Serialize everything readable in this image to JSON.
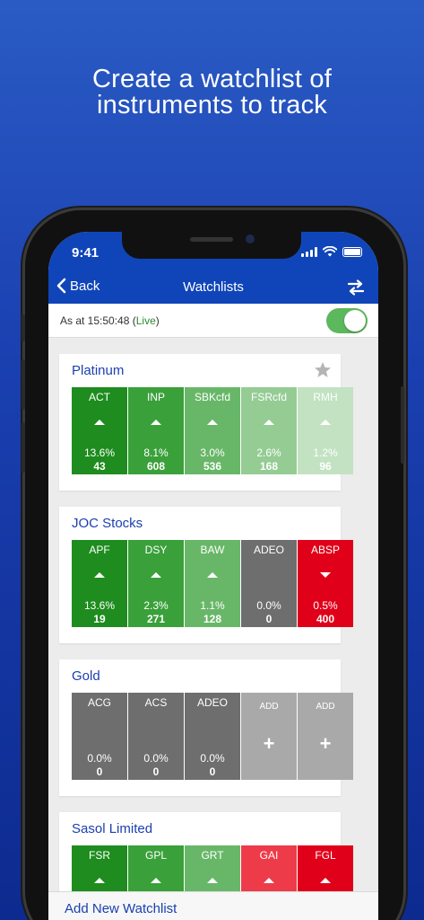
{
  "headline": {
    "line1": "Create a watchlist of",
    "line2": "instruments to track"
  },
  "status_bar": {
    "time": "9:41"
  },
  "nav": {
    "back_label": "Back",
    "title": "Watchlists"
  },
  "as_at": {
    "prefix": "As at 15:50:48 (",
    "live": "Live",
    "suffix": ")",
    "toggle_on": true
  },
  "colors": {
    "brand_blue": "#1045b9",
    "up_strong": "#1e8c1e",
    "up_medium": "#3aa03a",
    "up_light": "#68b768",
    "up_lighter": "#94cc94",
    "up_faint": "#c2e2c2",
    "neutral": "#6e6e6e",
    "down_strong": "#e1001a",
    "down_light": "#ee3b49",
    "add_tile": "#a9a9a9"
  },
  "watchlists": [
    {
      "name": "Platinum",
      "starred": false,
      "tiles": [
        {
          "symbol": "ACT",
          "direction": "up",
          "change": "13.6%",
          "value": "43",
          "color": "#1e8c1e"
        },
        {
          "symbol": "INP",
          "direction": "up",
          "change": "8.1%",
          "value": "608",
          "color": "#3aa03a"
        },
        {
          "symbol": "SBKcfd",
          "direction": "up",
          "change": "3.0%",
          "value": "536",
          "color": "#68b768"
        },
        {
          "symbol": "FSRcfd",
          "direction": "up",
          "change": "2.6%",
          "value": "168",
          "color": "#94cc94"
        },
        {
          "symbol": "RMH",
          "direction": "up",
          "change": "1.2%",
          "value": "96",
          "color": "#c2e2c2"
        }
      ]
    },
    {
      "name": "JOC Stocks",
      "tiles": [
        {
          "symbol": "APF",
          "direction": "up",
          "change": "13.6%",
          "value": "19",
          "color": "#1e8c1e"
        },
        {
          "symbol": "DSY",
          "direction": "up",
          "change": "2.3%",
          "value": "271",
          "color": "#3aa03a"
        },
        {
          "symbol": "BAW",
          "direction": "up",
          "change": "1.1%",
          "value": "128",
          "color": "#68b768"
        },
        {
          "symbol": "ADEO",
          "direction": "none",
          "change": "0.0%",
          "value": "0",
          "color": "#6e6e6e"
        },
        {
          "symbol": "ABSP",
          "direction": "down",
          "change": "0.5%",
          "value": "400",
          "color": "#e1001a"
        }
      ]
    },
    {
      "name": "Gold",
      "tiles": [
        {
          "symbol": "ACG",
          "direction": "none",
          "change": "0.0%",
          "value": "0",
          "color": "#6e6e6e"
        },
        {
          "symbol": "ACS",
          "direction": "none",
          "change": "0.0%",
          "value": "0",
          "color": "#6e6e6e"
        },
        {
          "symbol": "ADEO",
          "direction": "none",
          "change": "0.0%",
          "value": "0",
          "color": "#6e6e6e"
        },
        {
          "add": true,
          "label": "ADD",
          "plus": "+",
          "color": "#a9a9a9"
        },
        {
          "add": true,
          "label": "ADD",
          "plus": "+",
          "color": "#a9a9a9"
        }
      ]
    },
    {
      "name": "Sasol Limited",
      "tiles": [
        {
          "symbol": "FSR",
          "direction": "up",
          "change": "",
          "value": "",
          "color": "#1e8c1e"
        },
        {
          "symbol": "GPL",
          "direction": "up",
          "change": "",
          "value": "",
          "color": "#3aa03a"
        },
        {
          "symbol": "GRT",
          "direction": "up",
          "change": "",
          "value": "",
          "color": "#68b768"
        },
        {
          "symbol": "GAI",
          "direction": "up",
          "change": "",
          "value": "",
          "color": "#ee3b49"
        },
        {
          "symbol": "FGL",
          "direction": "up",
          "change": "",
          "value": "",
          "color": "#e1001a"
        }
      ]
    }
  ],
  "bottom_bar": {
    "add_label": "Add New Watchlist"
  }
}
